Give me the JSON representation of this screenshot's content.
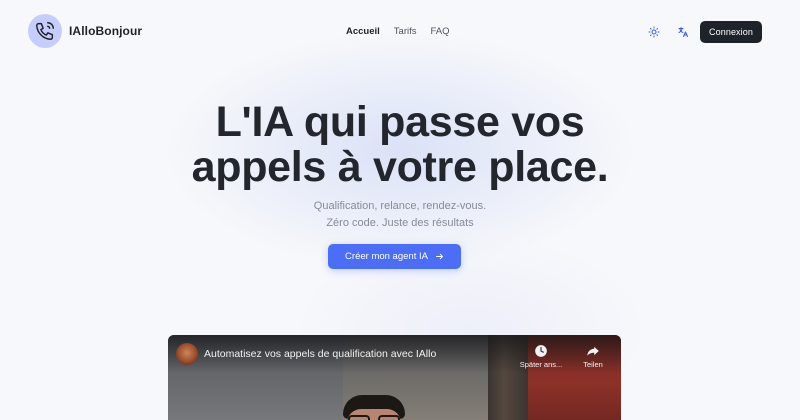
{
  "brand": {
    "name": "IAlloBonjour"
  },
  "nav": {
    "items": [
      "Accueil",
      "Tarifs",
      "FAQ"
    ],
    "active": "Accueil"
  },
  "header": {
    "theme_icon": "sun-icon",
    "language_icon": "translate-icon",
    "login_label": "Connexion"
  },
  "hero": {
    "title_line1": "L'IA qui passe vos",
    "title_line2": "appels à votre place.",
    "subtitle_line1": "Qualification, relance, rendez-vous.",
    "subtitle_line2": "Zéro code. Juste des résultats",
    "cta_label": "Créer mon agent IA",
    "cta_icon": "arrow-right-icon"
  },
  "video": {
    "title": "Automatisez vos appels de qualification avec IAllo",
    "watch_later_label": "Später ans...",
    "share_label": "Teilen"
  },
  "colors": {
    "accent": "#4c6ef6",
    "logo_bg": "#c6cdfb",
    "dark_button": "#1e232b"
  }
}
